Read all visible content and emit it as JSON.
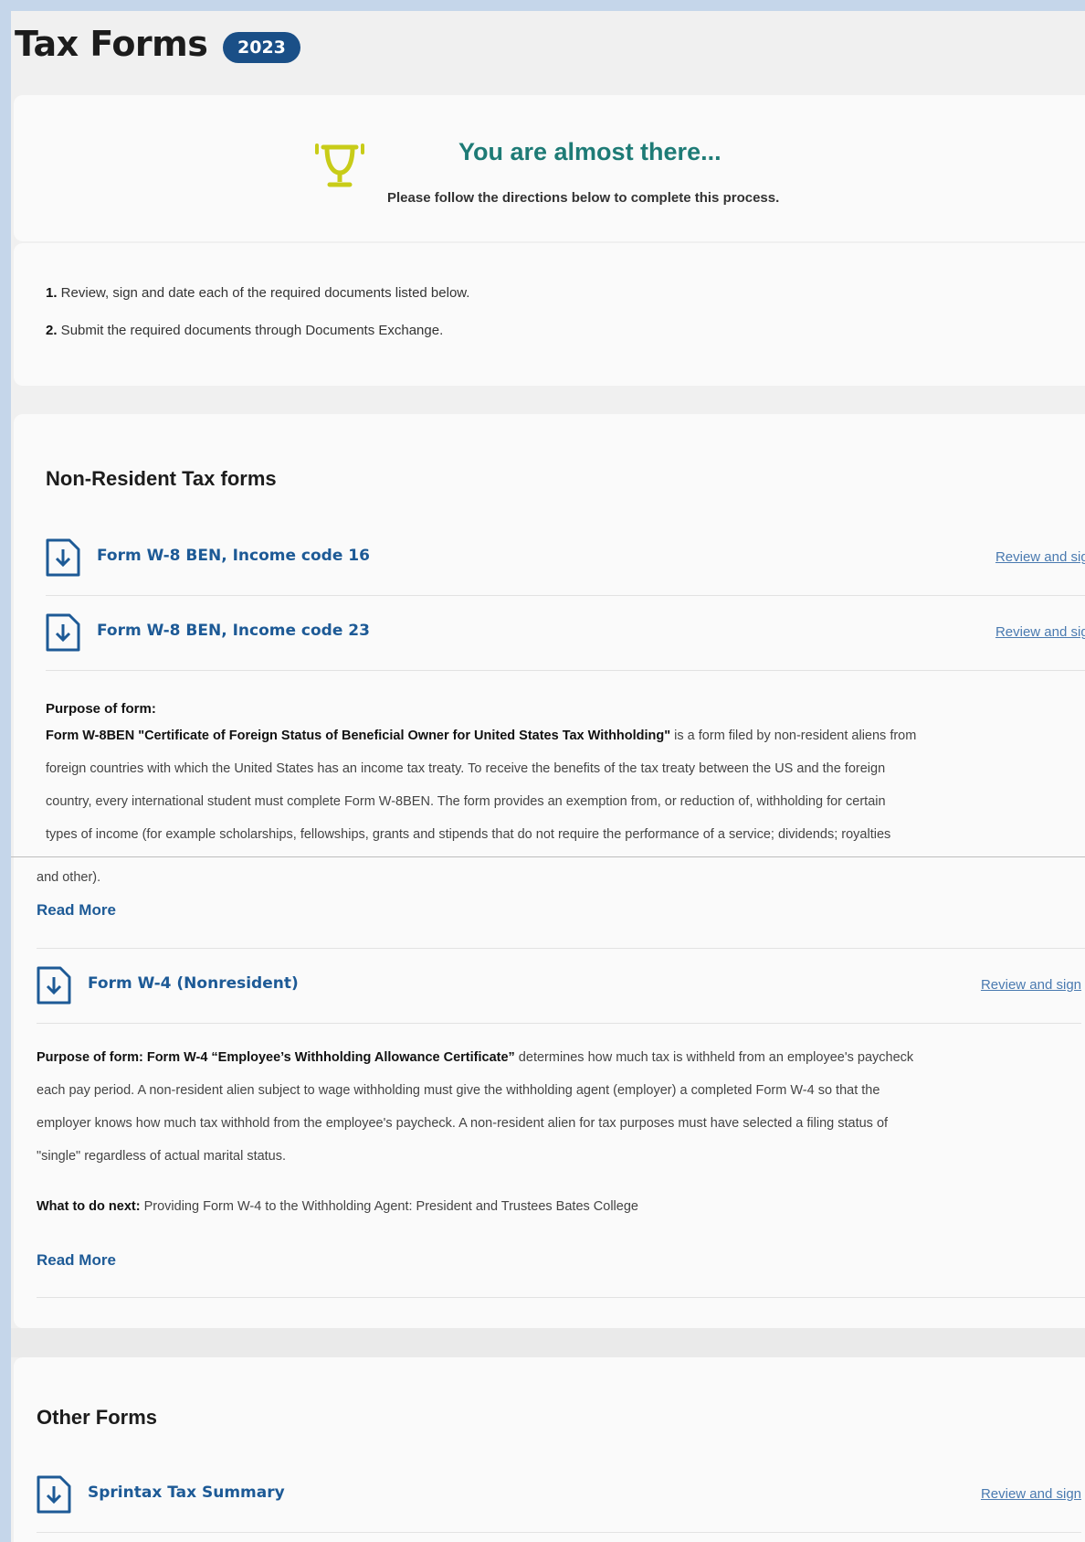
{
  "header": {
    "title": "Tax Forms",
    "year": "2023"
  },
  "hero": {
    "icon": "trophy-icon",
    "title": "You are almost there...",
    "subtitle": "Please follow the directions below to complete this process."
  },
  "steps": [
    {
      "num": "1.",
      "text": " Review, sign and date each of the required documents listed below."
    },
    {
      "num": "2.",
      "text": " Submit the required documents through Documents Exchange."
    }
  ],
  "non_resident": {
    "title": "Non-Resident Tax forms",
    "forms": [
      {
        "name": "Form W-8 BEN, Income code 16",
        "action": "Review and sign"
      },
      {
        "name": "Form W-8 BEN, Income code 23",
        "action": "Review and sign"
      }
    ],
    "purpose_label": "Purpose of form:",
    "w8_purpose_bold": "Form W-8BEN \"Certificate of Foreign Status of Beneficial Owner for United States Tax Withholding\"",
    "w8_purpose_line1": " is a form filed by non-resident aliens from",
    "w8_purpose_line2": "foreign countries with which the United States has an income tax treaty. To receive the benefits of the tax treaty between the US and the foreign",
    "w8_purpose_line3": "country, every international student must complete Form W-8BEN. The form provides an exemption from, or reduction of, withholding for certain",
    "w8_purpose_line4": "types of income (for example scholarships, fellowships, grants and stipends that do not require the performance of a service; dividends; royalties",
    "w8_purpose_line5": "and other).",
    "read_more_1": "Read More",
    "w4": {
      "name": "Form W-4 (Nonresident)",
      "action": "Review and sign"
    },
    "w4_purpose_bold": "Purpose of form: Form W-4 “Employee’s Withholding Allowance Certificate”",
    "w4_purpose_line1": " determines how much tax is withheld from an employee's paycheck",
    "w4_purpose_line2": "each pay period. A non-resident alien subject to wage withholding must give the withholding agent (employer) a completed Form W-4 so that the",
    "w4_purpose_line3": "employer knows how much tax withhold from the employee's paycheck. A non-resident alien for tax purposes must have selected a filing status of",
    "w4_purpose_line4": "\"single\" regardless of actual marital status.",
    "next_label": "What to do next:",
    "next_text": " Providing Form W-4 to the Withholding Agent: President and Trustees Bates College",
    "read_more_2": "Read More"
  },
  "other_forms": {
    "title": "Other Forms",
    "forms": [
      {
        "name": "Sprintax Tax Summary",
        "action": "Review and sign"
      }
    ]
  },
  "colors": {
    "accent_blue": "#1d5a96",
    "badge_blue": "#1a4f87",
    "hero_teal": "#1e7b76",
    "trophy_yellow": "#c8cc18",
    "outer_bg": "#c5d6ea"
  }
}
